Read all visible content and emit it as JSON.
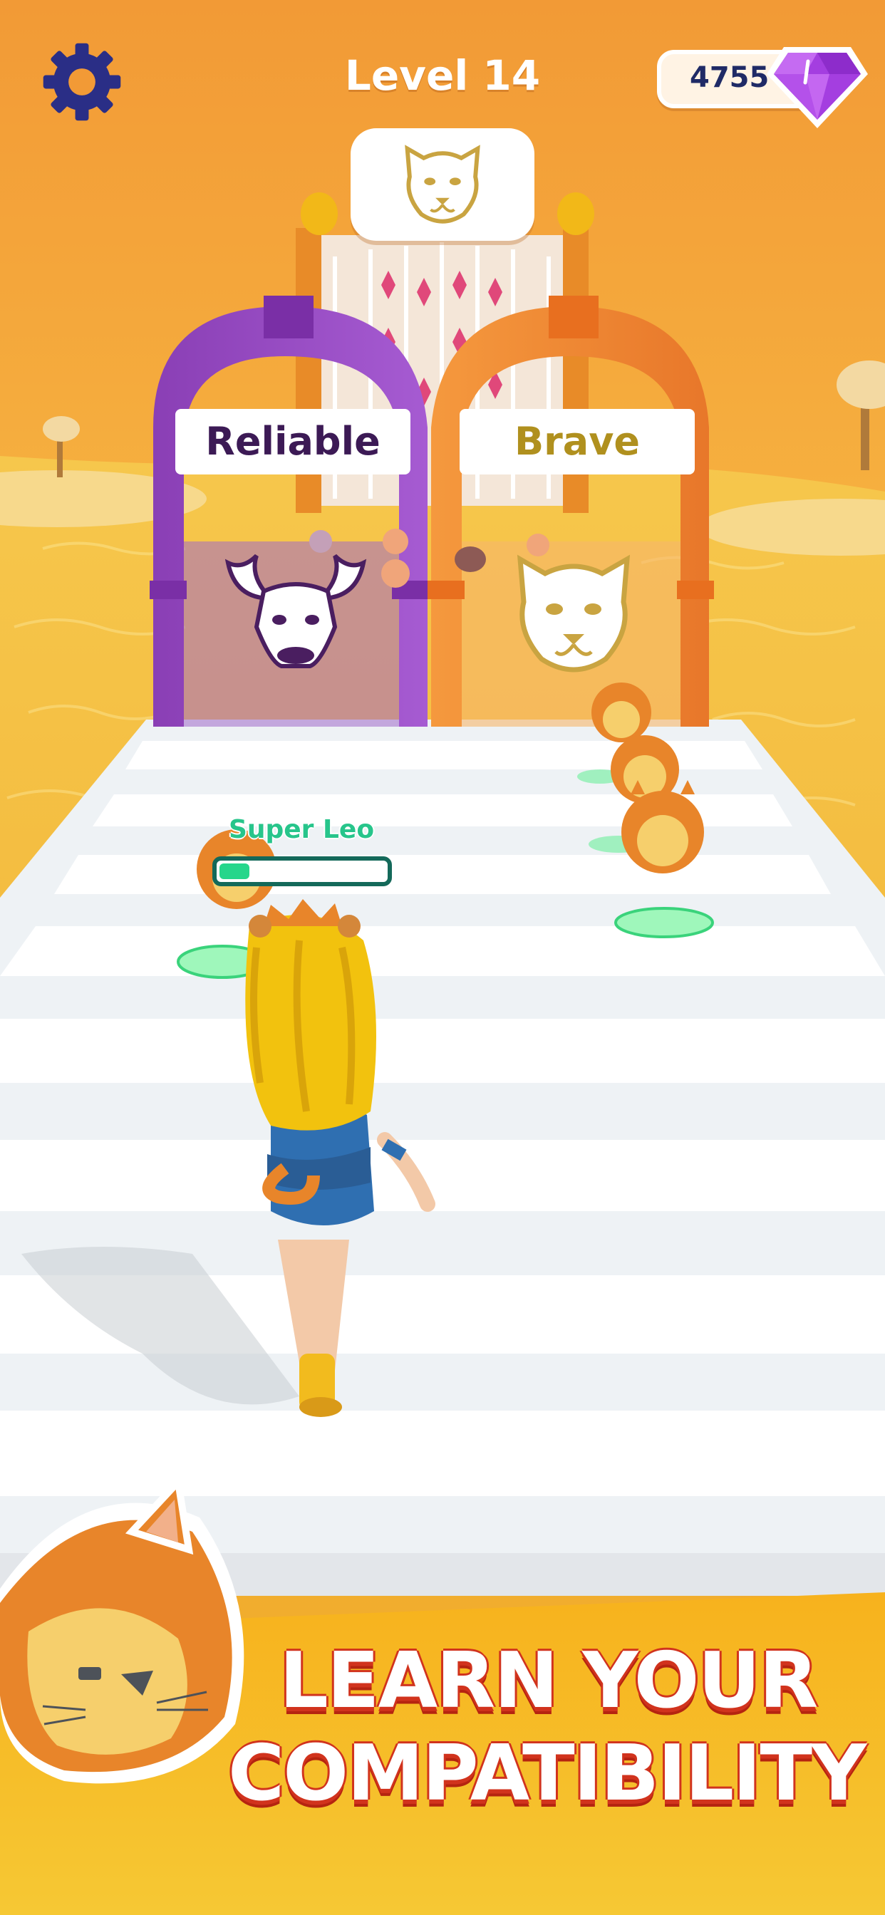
{
  "hud": {
    "level_title": "Level 14",
    "gem_count": "4755",
    "target_icon": "cheetah-face-icon",
    "settings_icon": "gear-icon",
    "gem_icon": "purple-diamond-icon"
  },
  "gates": {
    "left": {
      "label": "Reliable",
      "icon": "bull-face-icon",
      "color": "#9b4ec2"
    },
    "right": {
      "label": "Brave",
      "icon": "cheetah-face-icon",
      "color": "#f28a2e"
    }
  },
  "player": {
    "power_label": "Super Leo",
    "power_progress": 0.18
  },
  "promo": {
    "line1": "LEARN YOUR",
    "line2": "COMPATIBILITY",
    "mascot_icon": "lion-head-icon"
  },
  "colors": {
    "sky": "#f6a43a",
    "accent_red": "#d1331d",
    "gem_text": "#1f2a66",
    "progress_green": "#26d68b"
  }
}
